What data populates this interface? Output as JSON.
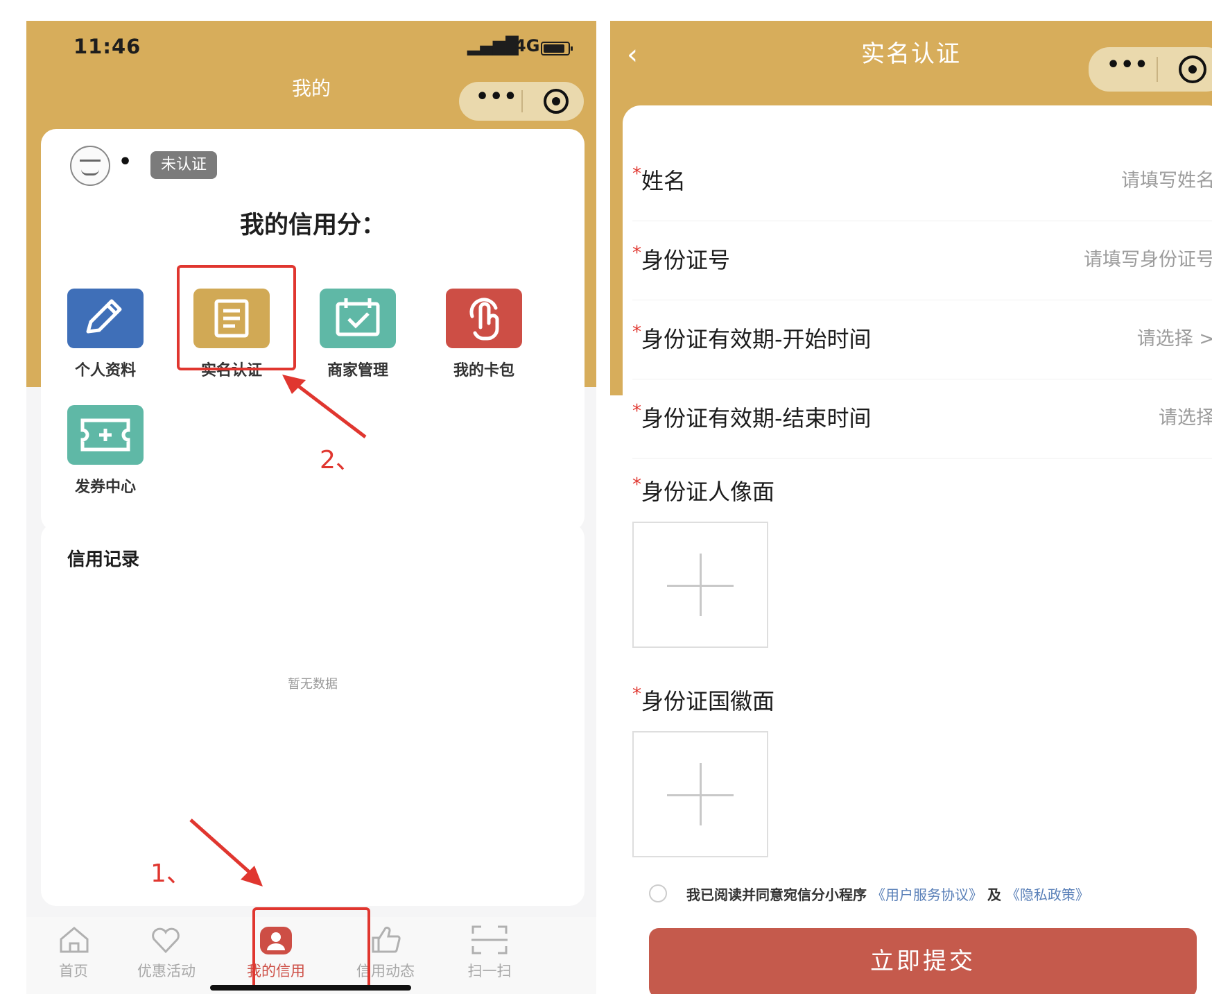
{
  "left": {
    "status": {
      "time": "11:46",
      "network": "4G"
    },
    "page_title": "我的",
    "capsule": {
      "more_icon": "•••",
      "close_icon": "target-icon"
    },
    "profile": {
      "name": "•",
      "badge": "未认证"
    },
    "credit_label": "我的信用分：",
    "grid": [
      {
        "label": "个人资料",
        "icon": "pencil-icon",
        "color": "#3f6fb8"
      },
      {
        "label": "实名认证",
        "icon": "document-icon",
        "color": "#d1a955"
      },
      {
        "label": "商家管理",
        "icon": "calendar-check-icon",
        "color": "#5fb8a6"
      },
      {
        "label": "我的卡包",
        "icon": "hand-pointer-icon",
        "color": "#cd4e45"
      },
      {
        "label": "发券中心",
        "icon": "ticket-icon",
        "color": "#5fb8a6"
      }
    ],
    "annotations": {
      "step1": "1、",
      "step2": "2、"
    },
    "records": {
      "title": "信用记录",
      "empty": "暂无数据"
    },
    "tabbar": [
      {
        "label": "首页",
        "icon": "home-icon"
      },
      {
        "label": "优惠活动",
        "icon": "heart-icon"
      },
      {
        "label": "我的信用",
        "icon": "user-icon",
        "active": true
      },
      {
        "label": "信用动态",
        "icon": "thumbs-up-icon"
      },
      {
        "label": "扫一扫",
        "icon": "scan-icon"
      }
    ],
    "colors": {
      "header": "#d7ad5b",
      "accent": "#e0362f",
      "active_tab": "#cd4e45"
    }
  },
  "right": {
    "title": "实名认证",
    "back_icon": "‹",
    "capsule": {
      "more_icon": "•••"
    },
    "fields": [
      {
        "label": "姓名",
        "value": "请填写姓名"
      },
      {
        "label": "身份证号",
        "value": "请填写身份证号"
      },
      {
        "label": "身份证有效期-开始时间",
        "value": "请选择 >"
      },
      {
        "label": "身份证有效期-结束时间",
        "value": "请选择"
      }
    ],
    "uploads": [
      {
        "label": "身份证人像面"
      },
      {
        "label": "身份证国徽面"
      }
    ],
    "required_mark": "*",
    "agreement": {
      "text": "我已阅读并同意宛信分小程序",
      "link1": "《用户服务协议》",
      "and": "及",
      "link2": "《隐私政策》"
    },
    "submit_label": "立即提交",
    "colors": {
      "submit": "#c55a4c",
      "link": "#5a80b8"
    }
  }
}
